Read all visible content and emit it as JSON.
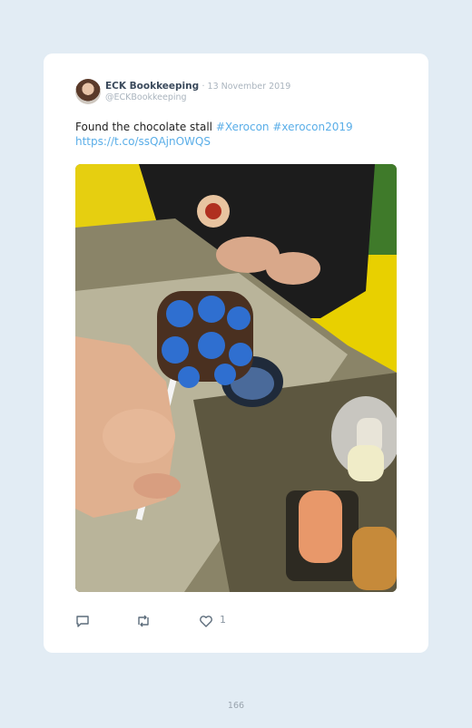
{
  "tweet": {
    "author_name": "ECK Bookkeeping",
    "date": "· 13 November 2019",
    "handle": "@ECKBookkeeping",
    "text_plain": "Found the chocolate stall ",
    "hashtag_1": "#Xerocon",
    "hashtag_2": "#xerocon2019",
    "url": "https://t.co/ssQAjnOWQS"
  },
  "actions": {
    "reply_icon": "reply-icon",
    "retweet_icon": "retweet-icon",
    "like_icon": "heart-icon",
    "like_count": "1"
  },
  "page": {
    "number": "166"
  },
  "colors": {
    "background": "#e2ecf4",
    "card": "#ffffff",
    "link": "#5aaee8",
    "muted": "#aab4be"
  }
}
